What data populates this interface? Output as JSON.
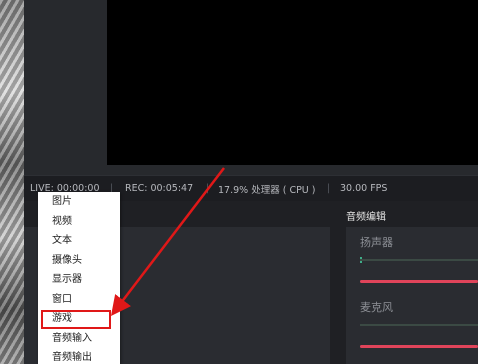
{
  "status": {
    "live": "LIVE: 00:00:00",
    "rec": "REC: 00:05:47",
    "cpu": "17.9% 处理器 ( CPU )",
    "fps": "30.00 FPS",
    "separator": "|"
  },
  "mixer": {
    "title": "音频编辑",
    "channels": [
      {
        "label": "扬声器"
      },
      {
        "label": "麦克风"
      }
    ]
  },
  "context_menu": {
    "items": [
      {
        "label": "图片"
      },
      {
        "label": "视频"
      },
      {
        "label": "文本"
      },
      {
        "label": "摄像头"
      },
      {
        "label": "显示器"
      },
      {
        "label": "窗口"
      },
      {
        "label": "游戏",
        "highlighted": true
      },
      {
        "label": "音频输入"
      },
      {
        "label": "音频输出"
      }
    ]
  },
  "colors": {
    "accent_slider": "#e0445a",
    "highlight_box": "#e01818",
    "annotation_arrow": "#e01818"
  }
}
